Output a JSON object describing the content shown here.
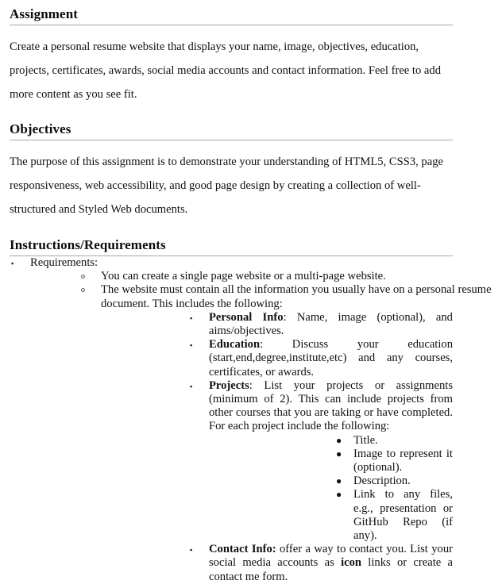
{
  "document": {
    "sections": [
      {
        "heading": "Assignment",
        "paragraph": "Create a personal resume website that displays your name, image, objectives, education, projects, certificates, awards, social media accounts and contact information. Feel free to add more content as you see fit."
      },
      {
        "heading": "Objectives",
        "paragraph": "The purpose of this assignment is to demonstrate your understanding of HTML5, CSS3, page responsiveness, web accessibility, and good page design by creating a collection of well-structured and Styled Web documents."
      },
      {
        "heading": "Instructions/Requirements"
      }
    ]
  },
  "markers": {
    "square": "▪",
    "circle": "o",
    "disc": "●"
  },
  "requirements": {
    "level1_label": "Requirements:",
    "level2": [
      {
        "text": "You can create a single page website or a multi-page website."
      },
      {
        "text": "The website must contain all the information you usually have on a personal resume document. This includes the following:"
      }
    ],
    "level3": [
      {
        "label": "Personal Info",
        "text": ": Name, image (optional), and aims/objectives."
      },
      {
        "label": "Education",
        "text": ": Discuss your education (start,end,degree,institute,etc) and any courses, certificates, or awards."
      },
      {
        "label": "Projects",
        "text": ": List your projects or assignments (minimum of 2). This can include projects from other courses that you are taking or have completed. For each project include the following:"
      }
    ],
    "level4": [
      {
        "text": "Title."
      },
      {
        "text": "Image to represent it (optional)."
      },
      {
        "text": "Description."
      },
      {
        "text": "Link to any files, e.g., presentation or GitHub Repo (if any)."
      }
    ],
    "contact": {
      "label": "Contact Info:",
      "text_before_bold": " offer a way to contact you. List your social media accounts as ",
      "bold_word": "icon",
      "text_after_bold": " links or create a contact me form."
    }
  }
}
